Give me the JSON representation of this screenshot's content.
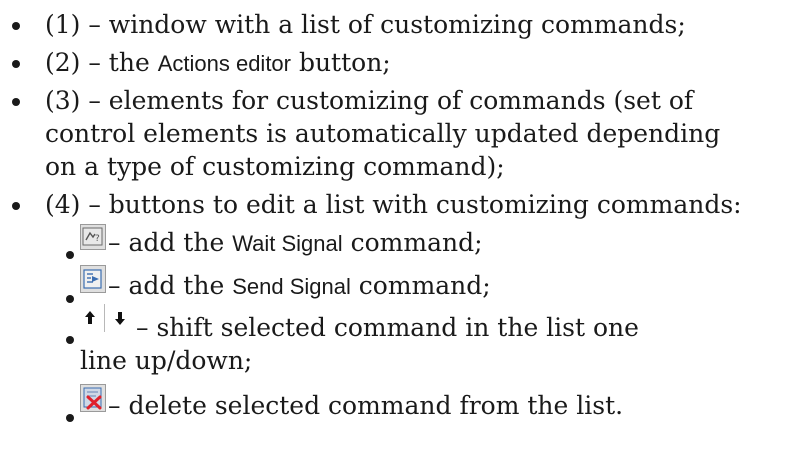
{
  "list": {
    "item1": {
      "text": "(1) – window with a list of customizing commands;"
    },
    "item2": {
      "pre": "(2) – the ",
      "ui": "Actions editor",
      "post": " button;"
    },
    "item3": {
      "line1": "(3) – elements for customizing of commands (set of",
      "line2": "control elements is automatically updated depending",
      "line3": "on a type of customizing command);"
    },
    "item4": {
      "text": "(4) – buttons to edit a list with customizing commands:",
      "sub": {
        "wait": {
          "pre": " – add the ",
          "ui": "Wait Signal",
          "post": " command;"
        },
        "send": {
          "pre": " – add the ",
          "ui": "Send Signal",
          "post": " command;"
        },
        "shift": {
          "line1": " – shift selected command in the list one",
          "line2": "line up/down;"
        },
        "delete": {
          "text": " – delete selected command from the list."
        }
      }
    }
  },
  "icons": {
    "wait": "wait-signal-icon",
    "send": "send-signal-icon",
    "up": "arrow-up-icon",
    "down": "arrow-down-icon",
    "delete": "delete-command-icon"
  },
  "colors": {
    "text": "#1a1a1a",
    "icon_bg": "#dfdfdf",
    "delete_red": "#e0202a",
    "icon_blue": "#3b6db0"
  }
}
